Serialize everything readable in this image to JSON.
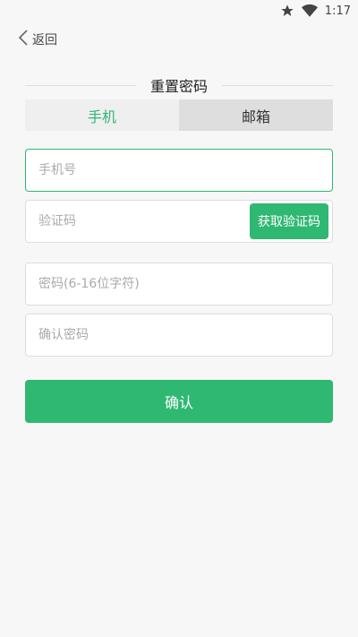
{
  "status_bar": {
    "time": "1:17"
  },
  "header": {
    "back_label": "返回"
  },
  "title": "重置密码",
  "tabs": [
    {
      "label": "手机",
      "active": true
    },
    {
      "label": "邮箱",
      "active": false
    }
  ],
  "form": {
    "phone_placeholder": "手机号",
    "code_placeholder": "验证码",
    "get_code_label": "获取验证码",
    "password_placeholder": "密码(6-16位字符)",
    "confirm_password_placeholder": "确认密码"
  },
  "confirm_label": "确认",
  "colors": {
    "accent": "#2fb872",
    "background": "#f7f7f7",
    "tab_active_bg": "#efefef",
    "tab_inactive_bg": "#dedede"
  }
}
